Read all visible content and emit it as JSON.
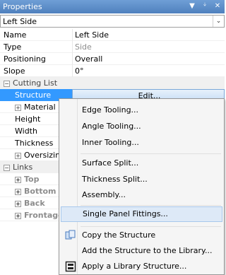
{
  "window": {
    "title": "Properties"
  },
  "selector": {
    "value": "Left Side"
  },
  "rows": {
    "name": {
      "label": "Name",
      "value": "Left Side"
    },
    "type": {
      "label": "Type",
      "value": "Side"
    },
    "positioning": {
      "label": "Positioning",
      "value": "Overall"
    },
    "slope": {
      "label": "Slope",
      "value": "0°"
    },
    "cutting_list": {
      "label": "Cutting List"
    },
    "structure": {
      "label": "Structure",
      "value": "Edit..."
    },
    "material": {
      "label": "Material"
    },
    "height": {
      "label": "Height"
    },
    "width": {
      "label": "Width"
    },
    "thickness": {
      "label": "Thickness"
    },
    "oversizing": {
      "label": "Oversizin"
    },
    "links": {
      "label": "Links"
    },
    "top": {
      "label": "Top"
    },
    "bottom": {
      "label": "Bottom"
    },
    "back": {
      "label": "Back"
    },
    "frontage": {
      "label": "Frontage"
    }
  },
  "menu": {
    "edge_tooling": "Edge Tooling...",
    "angle_tooling": "Angle Tooling...",
    "inner_tooling": "Inner Tooling...",
    "surface_split": "Surface Split...",
    "thickness_split": "Thickness Split...",
    "assembly": "Assembly...",
    "single_panel_fittings": "Single Panel Fittings...",
    "copy_structure": "Copy the Structure",
    "add_structure_library": "Add the Structure to the Library...",
    "apply_library_structure": "Apply a Library Structure..."
  }
}
